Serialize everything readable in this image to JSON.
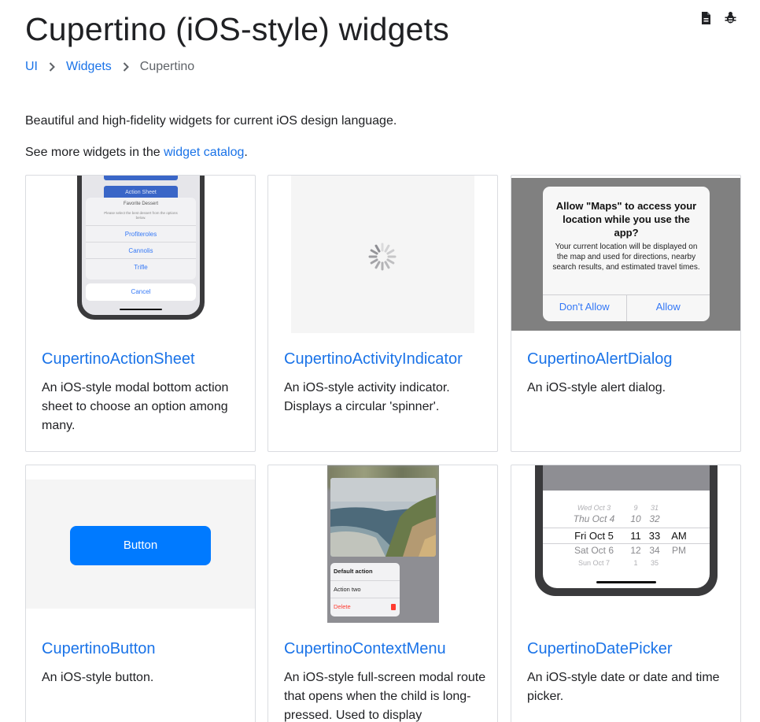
{
  "page": {
    "title": "Cupertino (iOS-style) widgets",
    "header_icons": [
      "document-icon",
      "bug-icon"
    ]
  },
  "breadcrumb": {
    "items": [
      "UI",
      "Widgets",
      "Cupertino"
    ]
  },
  "intro": {
    "description": "Beautiful and high-fidelity widgets for current iOS design language.",
    "see_more_prefix": "See more widgets in the ",
    "see_more_link": "widget catalog",
    "see_more_suffix": "."
  },
  "cards": [
    {
      "title": "CupertinoActionSheet",
      "description": "An iOS-style modal bottom action sheet to choose an option among many.",
      "preview": {
        "button_label": "Action Sheet",
        "sheet_title": "Favorite Dessert",
        "sheet_message": "Please select the best dessert from the options below.",
        "options": [
          "Profiteroles",
          "Cannolis",
          "Trifle"
        ],
        "cancel_label": "Cancel"
      }
    },
    {
      "title": "CupertinoActivityIndicator",
      "description": "An iOS-style activity indicator. Displays a circular 'spinner'."
    },
    {
      "title": "CupertinoAlertDialog",
      "description": "An iOS-style alert dialog.",
      "preview": {
        "alert_title": "Allow \"Maps\" to access your location while you use the app?",
        "alert_message": "Your current location will be displayed on the map and used for directions, nearby search results, and estimated travel times.",
        "buttons": [
          "Don't Allow",
          "Allow"
        ]
      }
    },
    {
      "title": "CupertinoButton",
      "description": "An iOS-style button.",
      "preview": {
        "button_label": "Button"
      }
    },
    {
      "title": "CupertinoContextMenu",
      "description": "An iOS-style full-screen modal route that opens when the child is long-pressed. Used to display",
      "preview": {
        "menu_items": [
          "Default action",
          "Action two",
          "Delete"
        ]
      }
    },
    {
      "title": "CupertinoDatePicker",
      "description": "An iOS-style date or date and time picker.",
      "preview": {
        "rows": [
          [
            "Wed Oct 3",
            "9",
            "31",
            ""
          ],
          [
            "Thu Oct 4",
            "10",
            "32",
            ""
          ],
          [
            "Fri Oct 5",
            "11",
            "33",
            "AM"
          ],
          [
            "Sat Oct 6",
            "12",
            "34",
            "PM"
          ],
          [
            "Sun Oct 7",
            "1",
            "35",
            ""
          ]
        ]
      }
    }
  ],
  "colors": {
    "link": "#1a73e8",
    "text": "#202124",
    "ios_blue": "#007aff"
  }
}
